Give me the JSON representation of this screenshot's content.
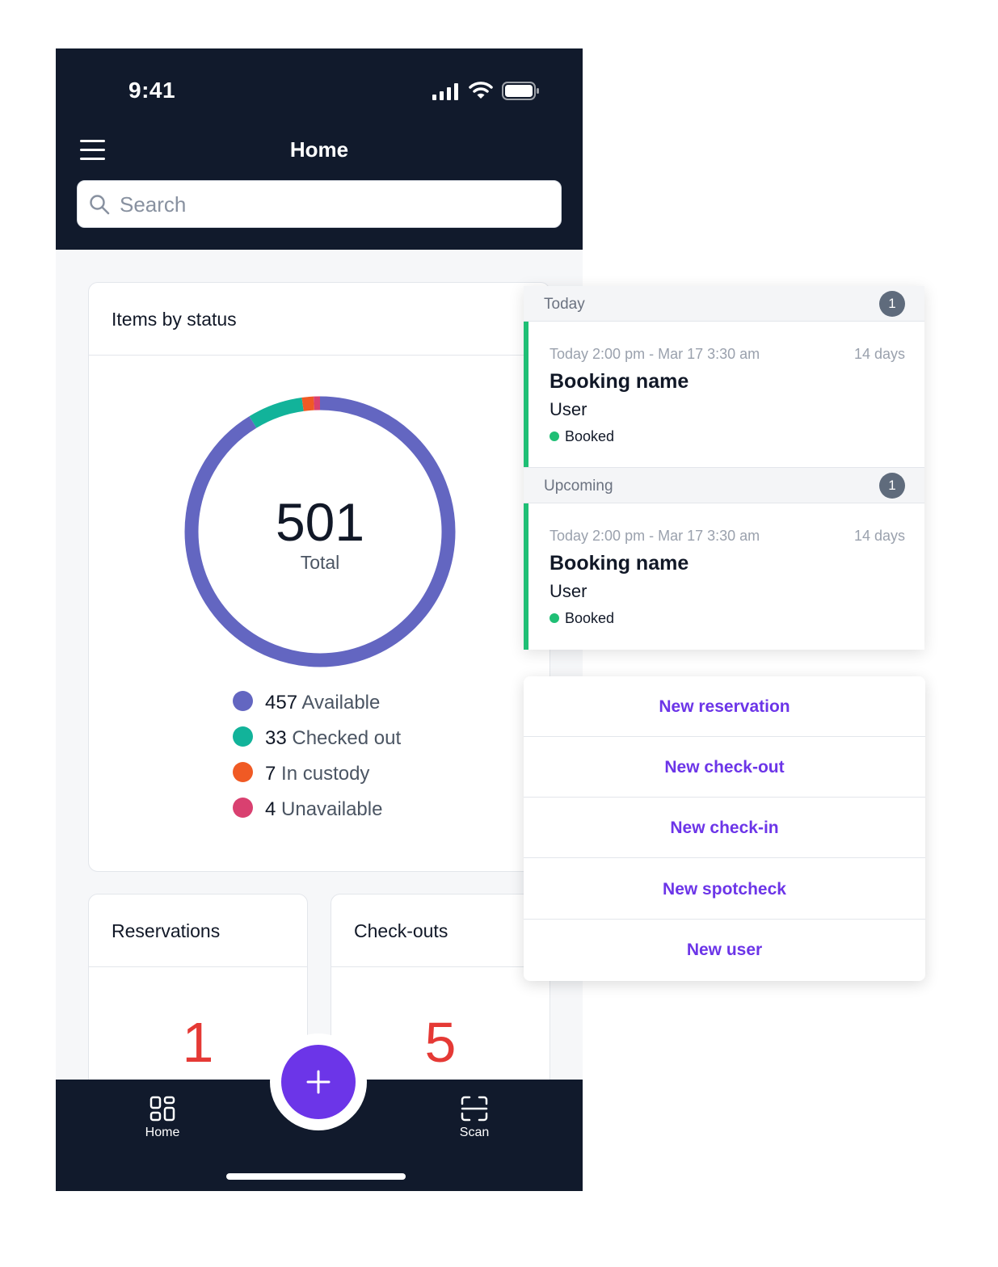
{
  "status_bar": {
    "time": "9:41"
  },
  "header": {
    "title": "Home",
    "menu_icon": "hamburger-menu-icon",
    "search": {
      "placeholder": "Search",
      "value": ""
    }
  },
  "status_card": {
    "title": "Items by status",
    "total": "501",
    "total_label": "Total",
    "chart_data": {
      "type": "pie",
      "categories": [
        "Available",
        "Checked out",
        "In custody",
        "Unavailable"
      ],
      "values": [
        457,
        33,
        7,
        4
      ],
      "colors": [
        "#6366c1",
        "#12b39a",
        "#f05a24",
        "#d94070"
      ]
    },
    "legend": [
      {
        "count": "457",
        "label": "Available",
        "color": "#6366c1"
      },
      {
        "count": "33",
        "label": "Checked out",
        "color": "#12b39a"
      },
      {
        "count": "7",
        "label": "In custody",
        "color": "#f05a24"
      },
      {
        "count": "4",
        "label": "Unavailable",
        "color": "#d94070"
      }
    ]
  },
  "reservations_card": {
    "title": "Reservations",
    "count": "1"
  },
  "checkouts_card": {
    "title": "Check-outs",
    "count": "5"
  },
  "bottom_nav": {
    "home_label": "Home",
    "scan_label": "Scan"
  },
  "bookings": {
    "today": {
      "title": "Today",
      "count": "1",
      "item": {
        "dates": "Today 2:00 pm  -  Mar 17 3:30 am",
        "duration": "14 days",
        "name": "Booking name",
        "user": "User",
        "status": "Booked"
      }
    },
    "upcoming": {
      "title": "Upcoming",
      "count": "1",
      "item": {
        "dates": "Today 2:00 pm  -  Mar 17 3:30 am",
        "duration": "14 days",
        "name": "Booking name",
        "user": "User",
        "status": "Booked"
      }
    }
  },
  "actions": [
    {
      "label": "New reservation"
    },
    {
      "label": "New check-out"
    },
    {
      "label": "New check-in"
    },
    {
      "label": "New spotcheck"
    },
    {
      "label": "New user"
    }
  ],
  "colors": {
    "accent": "#6c35e8",
    "dark": "#111a2c",
    "booked": "#1fbf75",
    "count_red": "#e53935"
  }
}
